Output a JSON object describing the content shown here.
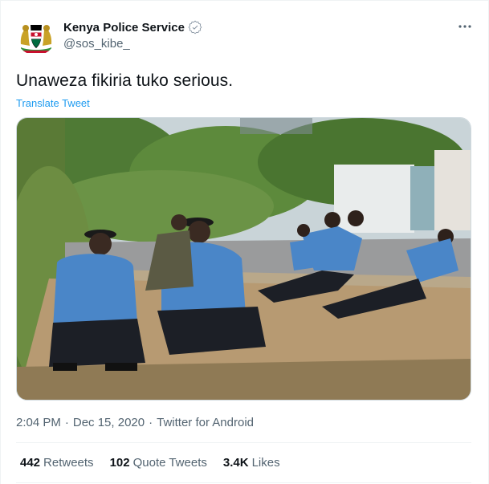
{
  "tweet": {
    "display_name": "Kenya Police Service",
    "handle": "@sos_kibe_",
    "text": "Unaweza fikiria tuko serious.",
    "translate_label": "Translate Tweet",
    "time": "2:04 PM",
    "separator": "·",
    "date": "Dec 15, 2020",
    "source": "Twitter for Android"
  },
  "stats": {
    "retweets_count": "442",
    "retweets_label": "Retweets",
    "quote_count": "102",
    "quote_label": "Quote Tweets",
    "likes_count": "3.4K",
    "likes_label": "Likes"
  },
  "colors": {
    "accent": "#1d9bf0",
    "secondary_text": "#536471",
    "primary_text": "#0f1419"
  },
  "icons": {
    "avatar": "kenya-coat-of-arms-icon",
    "verified": "verified-badge-icon",
    "more": "more-options-icon"
  }
}
